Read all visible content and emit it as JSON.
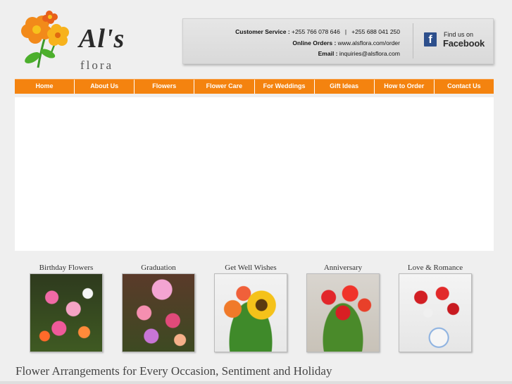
{
  "logo": {
    "text": "Al's",
    "sub": "flora"
  },
  "contact": {
    "customer_service_label": "Customer Service :",
    "phone1": "+255 766 078 646",
    "separator": "|",
    "phone2": "+255 688 041 250",
    "online_orders_label": "Online Orders :",
    "online_orders_value": "www.alsflora.com/order",
    "email_label": "Email :",
    "email_value": "inquiries@alsflora.com"
  },
  "facebook": {
    "icon": "f",
    "small": "Find us on",
    "big": "Facebook"
  },
  "nav": {
    "items": [
      "Home",
      "About Us",
      "Flowers",
      "Flower Care",
      "For Weddings",
      "Gift Ideas",
      "How to Order",
      "Contact Us"
    ]
  },
  "categories": [
    {
      "label": "Birthday Flowers"
    },
    {
      "label": "Graduation"
    },
    {
      "label": "Get Well Wishes"
    },
    {
      "label": "Anniversary"
    },
    {
      "label": "Love & Romance"
    }
  ],
  "tagline": "Flower Arrangements for Every Occasion, Sentiment and Holiday",
  "colors": {
    "nav": "#f4830f",
    "background": "#efefef",
    "facebook": "#2d4f8c"
  }
}
